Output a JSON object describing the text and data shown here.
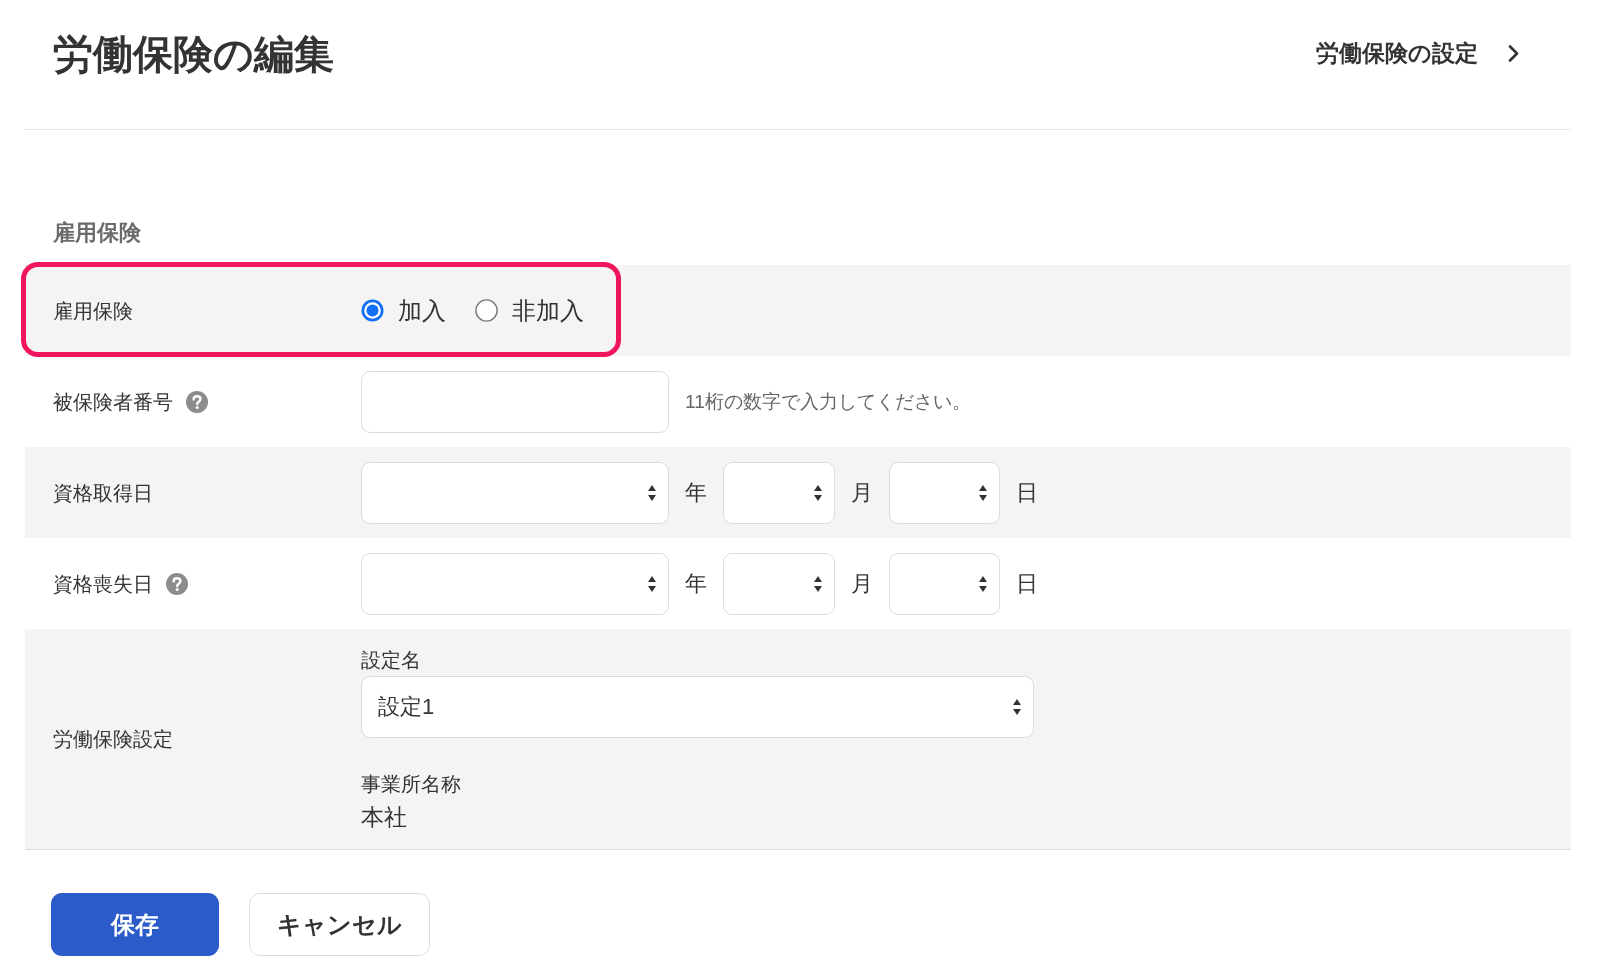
{
  "header": {
    "title": "労働保険の編集",
    "settings_link": "労働保険の設定"
  },
  "section": {
    "heading": "雇用保険",
    "rows": [
      {
        "kind": "radio",
        "label": "雇用保険",
        "help": false,
        "highlighted": true,
        "options": [
          {
            "label": "加入",
            "selected": true
          },
          {
            "label": "非加入",
            "selected": false
          }
        ]
      },
      {
        "kind": "text",
        "label": "被保険者番号",
        "help": true,
        "highlighted": false,
        "hint": "11桁の数字で入力してください。"
      },
      {
        "kind": "date",
        "label": "資格取得日",
        "help": false,
        "highlighted": false,
        "units": [
          "年",
          "月",
          "日"
        ]
      },
      {
        "kind": "date",
        "label": "資格喪失日",
        "help": true,
        "highlighted": false,
        "units": [
          "年",
          "月",
          "日"
        ]
      },
      {
        "kind": "setting",
        "label": "労働保険設定",
        "help": false,
        "highlighted": false,
        "select_label": "設定名",
        "select_value": "設定1",
        "office_label": "事業所名称",
        "office_value": "本社"
      }
    ]
  },
  "buttons": [
    {
      "kind": "primary",
      "label": "保存"
    },
    {
      "kind": "secondary",
      "label": "キャンセル"
    }
  ]
}
